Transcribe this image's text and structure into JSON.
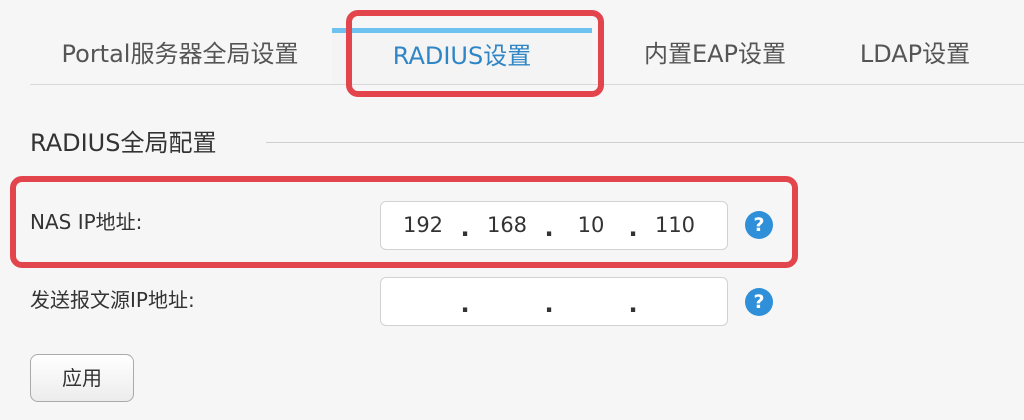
{
  "tabs": [
    {
      "label": "Portal服务器全局设置",
      "active": false
    },
    {
      "label": "RADIUS设置",
      "active": true
    },
    {
      "label": "内置EAP设置",
      "active": false
    },
    {
      "label": "LDAP设置",
      "active": false
    }
  ],
  "section": {
    "title": "RADIUS全局配置"
  },
  "fields": {
    "nas_ip": {
      "label": "NAS IP地址:",
      "octets": [
        "192",
        "168",
        "10",
        "110"
      ],
      "dot": ".",
      "help_icon": "question-circle-icon"
    },
    "source_ip": {
      "label": "发送报文源IP地址:",
      "octets": [
        "",
        "",
        "",
        ""
      ],
      "dot": ".",
      "help_icon": "question-circle-icon"
    }
  },
  "help_glyph": "?",
  "apply_label": "应用",
  "colors": {
    "active_tab_text": "#2f86c6",
    "active_tab_indicator": "#6ec2ef",
    "highlight_border": "#e3454d",
    "help_icon_bg": "#2f8fd8"
  }
}
